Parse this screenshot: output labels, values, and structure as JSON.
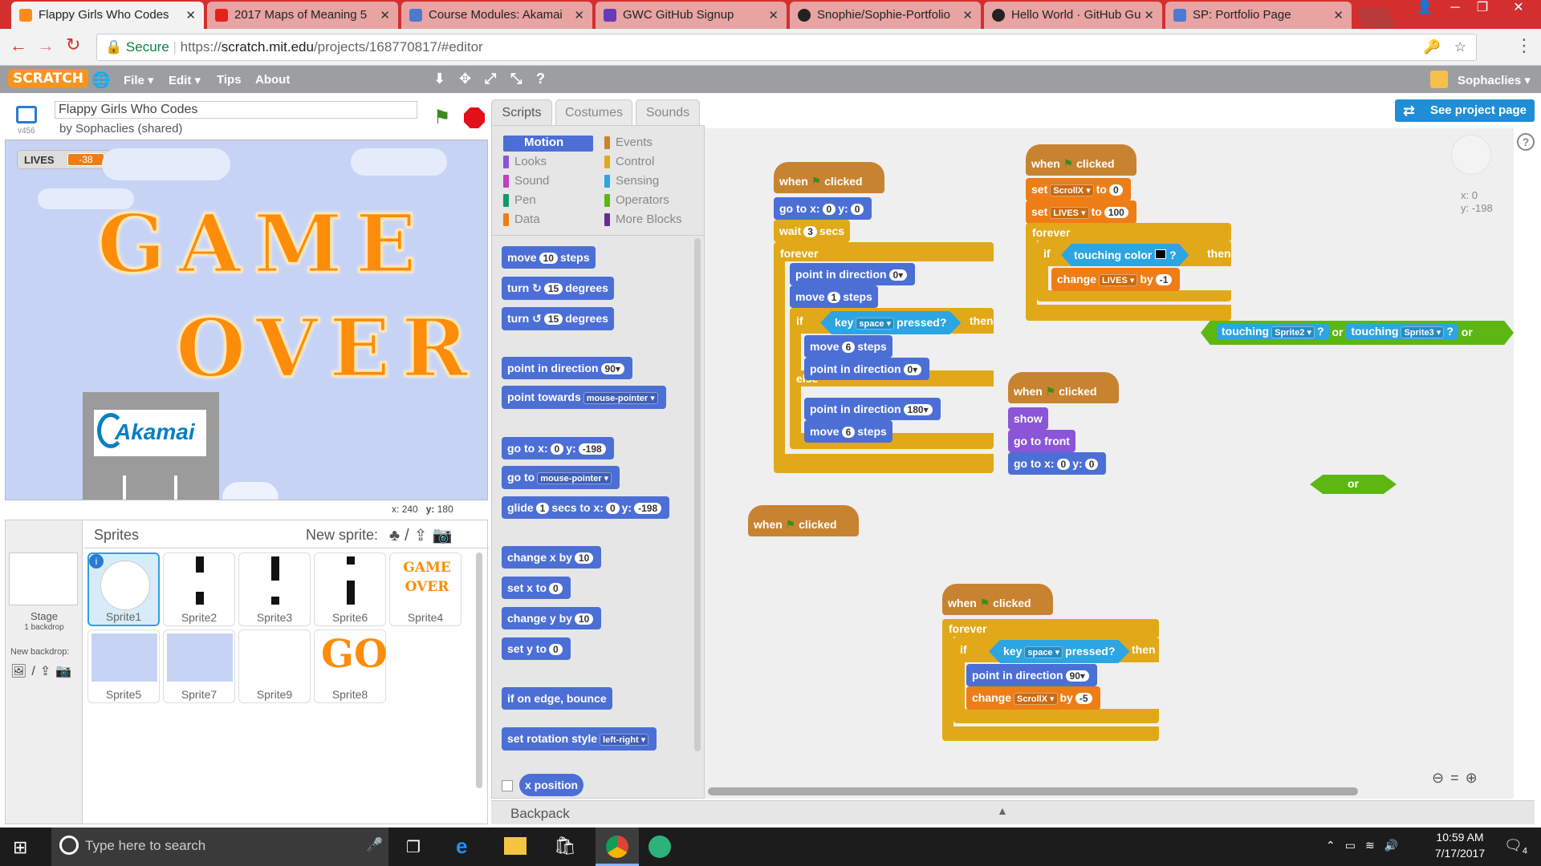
{
  "browser": {
    "tabs": [
      {
        "title": "Flappy Girls Who Codes",
        "active": true,
        "icon_color": "#ff8c1a"
      },
      {
        "title": "2017 Maps of Meaning 5",
        "active": false,
        "icon_color": "#e62117"
      },
      {
        "title": "Course Modules: Akamai",
        "active": false,
        "icon_color": "#4a7bd0"
      },
      {
        "title": "GWC GitHub Signup",
        "active": false,
        "icon_color": "#673ab7"
      },
      {
        "title": "Snophie/Sophie-Portfolio",
        "active": false,
        "icon_color": "#222222"
      },
      {
        "title": "Hello World · GitHub Gu",
        "active": false,
        "icon_color": "#222222"
      },
      {
        "title": "SP: Portfolio Page",
        "active": false,
        "icon_color": "#4a7bd0"
      }
    ],
    "secure_label": "Secure",
    "url_prefix": "https://",
    "url_host": "scratch.mit.edu",
    "url_path": "/projects/168770817/#editor"
  },
  "scratch_menu": {
    "logo": "SCRATCH",
    "file": "File ▾",
    "edit": "Edit ▾",
    "tips": "Tips",
    "about": "About",
    "user": "Sophaclies ▾"
  },
  "project": {
    "title": "Flappy Girls Who Codes",
    "author": "by Sophaclies (shared)",
    "version": "v456",
    "see_project": "See project page"
  },
  "stage": {
    "lives_label": "LIVES",
    "lives_value": "-38",
    "game_text": "GAME",
    "over_text": "OVER",
    "akamai": "Akamai",
    "x_label": "x:",
    "x_value": "240",
    "y_label": "y:",
    "y_value": "180"
  },
  "sprites_panel": {
    "title": "Sprites",
    "new_sprite": "New sprite:",
    "stage_label": "Stage",
    "stage_sub": "1 backdrop",
    "new_backdrop": "New backdrop:",
    "sprites": [
      "Sprite1",
      "Sprite2",
      "Sprite3",
      "Sprite6",
      "Sprite4",
      "Sprite5",
      "Sprite7",
      "Sprite9",
      "Sprite8"
    ],
    "go_text": "GO",
    "game_over_small": "GAME OVER"
  },
  "editor": {
    "tabs": [
      "Scripts",
      "Costumes",
      "Sounds"
    ],
    "categories_left": [
      {
        "name": "Motion",
        "color": "#4c6fd6"
      },
      {
        "name": "Looks",
        "color": "#8a55d7"
      },
      {
        "name": "Sound",
        "color": "#bb42c3"
      },
      {
        "name": "Pen",
        "color": "#0e9a6c"
      },
      {
        "name": "Data",
        "color": "#ee7d16"
      }
    ],
    "categories_right": [
      {
        "name": "Events",
        "color": "#c88330"
      },
      {
        "name": "Control",
        "color": "#e1a91a"
      },
      {
        "name": "Sensing",
        "color": "#2ca5e2"
      },
      {
        "name": "Operators",
        "color": "#5cb712"
      },
      {
        "name": "More Blocks",
        "color": "#632d99"
      }
    ],
    "palette_blocks": {
      "move": "move",
      "move_val": "10",
      "steps": "steps",
      "turn": "turn",
      "turn_val": "15",
      "degrees": "degrees",
      "point_dir": "point in direction",
      "point_dir_val": "90▾",
      "point_towards": "point towards",
      "point_towards_val": "mouse-pointer ▾",
      "goto_xy": "go to x:",
      "goto_x": "0",
      "y_lbl": "y:",
      "goto_y": "-198",
      "goto": "go to",
      "goto_val": "mouse-pointer ▾",
      "glide": "glide",
      "glide_val": "1",
      "secs_to_x": "secs to x:",
      "glide_x": "0",
      "glide_y": "-198",
      "change_x": "change x by",
      "change_x_val": "10",
      "set_x": "set x to",
      "set_x_val": "0",
      "change_y": "change y by",
      "change_y_val": "10",
      "set_y": "set y to",
      "set_y_val": "0",
      "bounce": "if on edge, bounce",
      "rotation": "set rotation style",
      "rotation_val": "left-right ▾",
      "x_position": "x position"
    },
    "backpack": "Backpack",
    "sprite_coords_x": "x: 0",
    "sprite_coords_y": "y: -198"
  },
  "scripts": {
    "when": "when",
    "clicked": "clicked",
    "goto_x": "go to x:",
    "x0": "0",
    "y": "y:",
    "y0": "0",
    "wait": "wait",
    "wait_val": "3",
    "secs": "secs",
    "forever": "forever",
    "point_dir": "point in direction",
    "d0": "0▾",
    "d180": "180▾",
    "d90": "90▾",
    "move": "move",
    "one": "1",
    "six": "6",
    "steps": "steps",
    "if": "if",
    "then": "then",
    "else": "else",
    "key": "key",
    "space": "space ▾",
    "pressed": "pressed?",
    "set": "set",
    "scrollx": "ScrollX ▾",
    "lives": "LIVES ▾",
    "to": "to",
    "zero": "0",
    "hundred": "100",
    "touching_color": "touching color",
    "q": "?",
    "change": "change",
    "by": "by",
    "minus1": "-1",
    "minus5": "-5",
    "touching": "touching",
    "sprite2": "Sprite2 ▾",
    "sprite3": "Sprite3 ▾",
    "or": "or",
    "show": "show",
    "go_front": "go to front"
  },
  "taskbar": {
    "search_placeholder": "Type here to search",
    "time": "10:59 AM",
    "date": "7/17/2017",
    "notifications": "4"
  }
}
